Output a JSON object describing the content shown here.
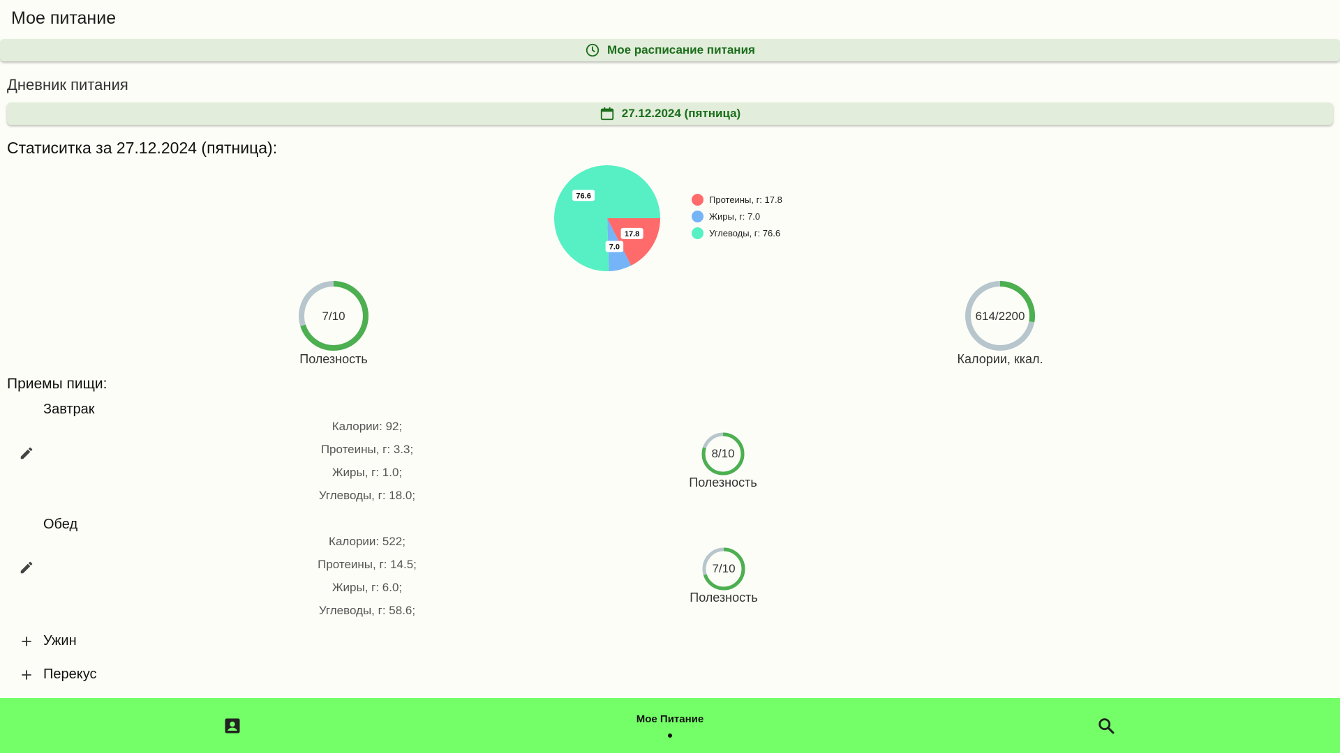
{
  "app": {
    "title": "Мое питание"
  },
  "schedule_button": {
    "label": "Мое расписание питания",
    "icon": "clock-icon"
  },
  "diary": {
    "label": "Дневник питания",
    "date_button": {
      "label": "27.12.2024 (пятница)",
      "icon": "calendar-icon"
    }
  },
  "stats": {
    "title": "Статиситка за 27.12.2024 (пятница):",
    "legend": [
      {
        "label": "Протеины, г: 17.8",
        "color": "#ff6b6b"
      },
      {
        "label": "Жиры, г: 7.0",
        "color": "#74b4f7"
      },
      {
        "label": "Углеводы, г: 76.6",
        "color": "#56f0c4"
      }
    ],
    "slice_labels": [
      "17.8",
      "7.0",
      "76.6"
    ],
    "usefulness": {
      "value_text": "7/10",
      "label": "Полезность",
      "fraction": 0.7
    },
    "calories": {
      "value_text": "614/2200",
      "label": "Калории, ккал.",
      "fraction": 0.279
    }
  },
  "chart_data": {
    "type": "pie",
    "categories": [
      "Протеины, г",
      "Жиры, г",
      "Углеводы, г"
    ],
    "values": [
      17.8,
      7.0,
      76.6
    ],
    "colors": [
      "#ff6b6b",
      "#74b4f7",
      "#56f0c4"
    ]
  },
  "meals": {
    "title": "Приемы пищи:",
    "items": [
      {
        "name": "Завтрак",
        "calories": "Калории: 92;",
        "proteins": "Протеины, г: 3.3;",
        "fats": "Жиры, г: 1.0;",
        "carbs": "Углеводы, г: 18.0;",
        "usefulness_text": "8/10",
        "usefulness_label": "Полезность",
        "fraction": 0.8
      },
      {
        "name": "Обед",
        "calories": "Калории: 522;",
        "proteins": "Протеины, г: 14.5;",
        "fats": "Жиры, г: 6.0;",
        "carbs": "Углеводы, г: 58.6;",
        "usefulness_text": "7/10",
        "usefulness_label": "Полезность",
        "fraction": 0.7
      }
    ],
    "add_items": [
      "Ужин",
      "Перекус"
    ]
  },
  "bottom_nav": {
    "center_label": "Мое Питание",
    "left_icon": "profile-icon",
    "right_icon": "search-icon"
  },
  "colors": {
    "ring_fill": "#4caf50",
    "ring_track": "#b7c6cc",
    "nav_bg": "#74ff68",
    "accent_text": "#1b6e1b"
  }
}
